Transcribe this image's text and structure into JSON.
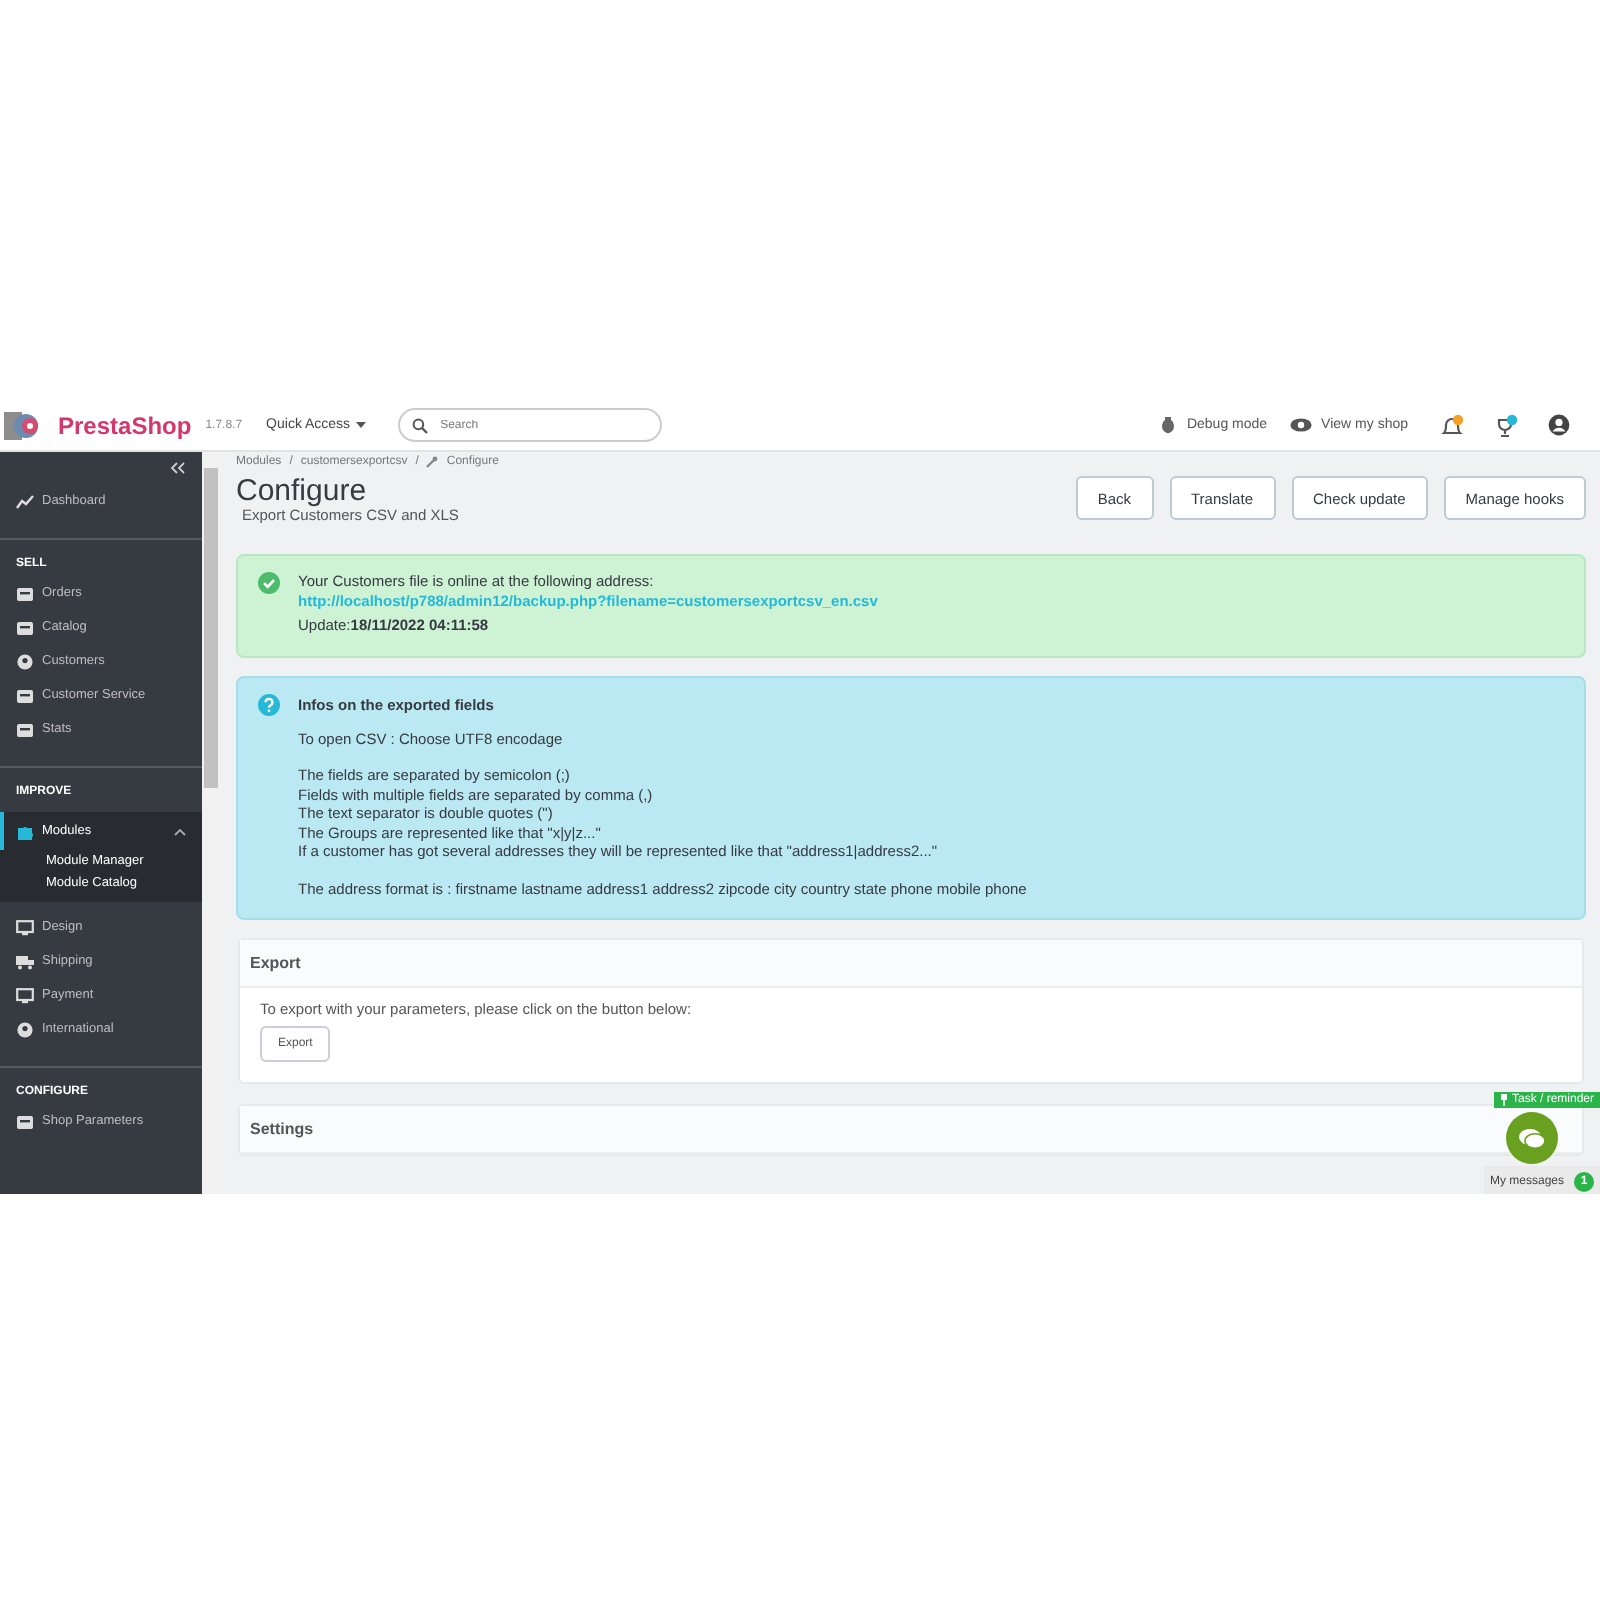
{
  "topbar": {
    "logo": "PrestaShop",
    "version": "1.7.8.7",
    "quick_access": "Quick Access",
    "search": {
      "placeholder": "Search"
    },
    "debug_mode": "Debug mode",
    "view_shop": "View my shop"
  },
  "sidebar": {
    "items": [
      {
        "kind": "link",
        "label": "Dashboard",
        "selected": false
      },
      {
        "kind": "section",
        "label": "SELL"
      },
      {
        "kind": "link",
        "label": "Orders",
        "selected": false
      },
      {
        "kind": "link",
        "label": "Catalog",
        "selected": false
      },
      {
        "kind": "link",
        "label": "Customers",
        "selected": false
      },
      {
        "kind": "link",
        "label": "Customer Service",
        "selected": false
      },
      {
        "kind": "link",
        "label": "Stats",
        "selected": false
      },
      {
        "kind": "section",
        "label": "IMPROVE"
      },
      {
        "kind": "link",
        "label": "Modules",
        "selected": true,
        "expanded": true,
        "children": [
          {
            "label": "Module Manager"
          },
          {
            "label": "Module Catalog"
          }
        ]
      },
      {
        "kind": "link",
        "label": "Design",
        "selected": false
      },
      {
        "kind": "link",
        "label": "Shipping",
        "selected": false
      },
      {
        "kind": "link",
        "label": "Payment",
        "selected": false
      },
      {
        "kind": "link",
        "label": "International",
        "selected": false
      },
      {
        "kind": "section",
        "label": "CONFIGURE"
      },
      {
        "kind": "link",
        "label": "Shop Parameters",
        "selected": false
      }
    ]
  },
  "header": {
    "breadcrumb_separator": "/",
    "breadcrumb": [
      "Modules",
      "customersexportcsv",
      "Configure"
    ],
    "title": "Configure",
    "subtitle": "Export Customers CSV and XLS",
    "buttons": [
      "Back",
      "Translate",
      "Check update",
      "Manage hooks"
    ]
  },
  "success_alert": {
    "text": "Your Customers file is online at the following address:",
    "link": "http://localhost/p788/admin12/backup.php?filename=customersexportcsv_en.csv",
    "update": "Update:**18/11/2022 04:11:58**"
  },
  "info_alert": {
    "title": "Infos on the exported fields",
    "paragraphs": [
      [
        "To open CSV : Choose UTF8 encodage"
      ],
      [
        "The fields are separated by semicolon (;)",
        "Fields with multiple fields are separated by comma (,)",
        "The text separator is double quotes (\")",
        "The Groups are represented like that \"x|y|z...\"",
        "If a customer has got several addresses they will be represented like that \"address1|address2...\""
      ],
      [
        "The address format is : firstname lastname address1 address2 zipcode city country state phone mobile phone"
      ]
    ]
  },
  "export_panel": {
    "title": "Export",
    "text": "To export with your parameters, please click on the button below:",
    "button": "Export"
  },
  "settings_panel": {
    "title": "Settings"
  },
  "widgets": {
    "task_reminder": "Task / reminder",
    "messages": "My messages",
    "messages_count": "1"
  }
}
